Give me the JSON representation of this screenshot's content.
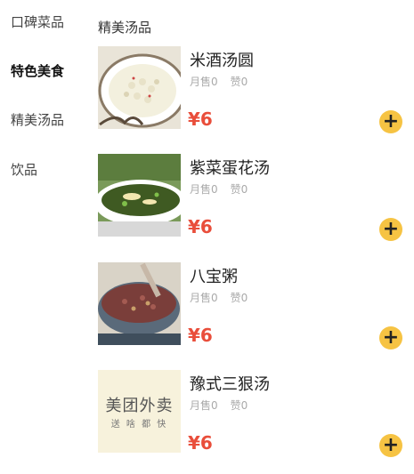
{
  "sidebar": {
    "items": [
      {
        "label": "口碑菜品",
        "active": false
      },
      {
        "label": "特色美食",
        "active": true
      },
      {
        "label": "精美汤品",
        "active": false
      },
      {
        "label": "饮品",
        "active": false
      }
    ]
  },
  "main": {
    "section_title": "精美汤品",
    "dishes": [
      {
        "name": "米酒汤圆",
        "sales": "月售0",
        "likes": "赞0",
        "price": "¥6",
        "image": "rice-wine-dumpling-soup-photo"
      },
      {
        "name": "紫菜蛋花汤",
        "sales": "月售0",
        "likes": "赞0",
        "price": "¥6",
        "image": "seaweed-egg-soup-photo"
      },
      {
        "name": "八宝粥",
        "sales": "月售0",
        "likes": "赞0",
        "price": "¥6",
        "image": "eight-treasure-porridge-photo"
      },
      {
        "name": "豫式三狠汤",
        "sales": "月售0",
        "likes": "赞0",
        "price": "¥6",
        "image": "meituan-waimai-placeholder",
        "placeholder_title": "美团外卖",
        "placeholder_sub": "送 啥 都 快"
      }
    ],
    "add_button": "+"
  },
  "colors": {
    "price": "#e94e3b",
    "add_button": "#f6c343",
    "active_text": "#111111",
    "muted_text": "#aaaaaa"
  }
}
